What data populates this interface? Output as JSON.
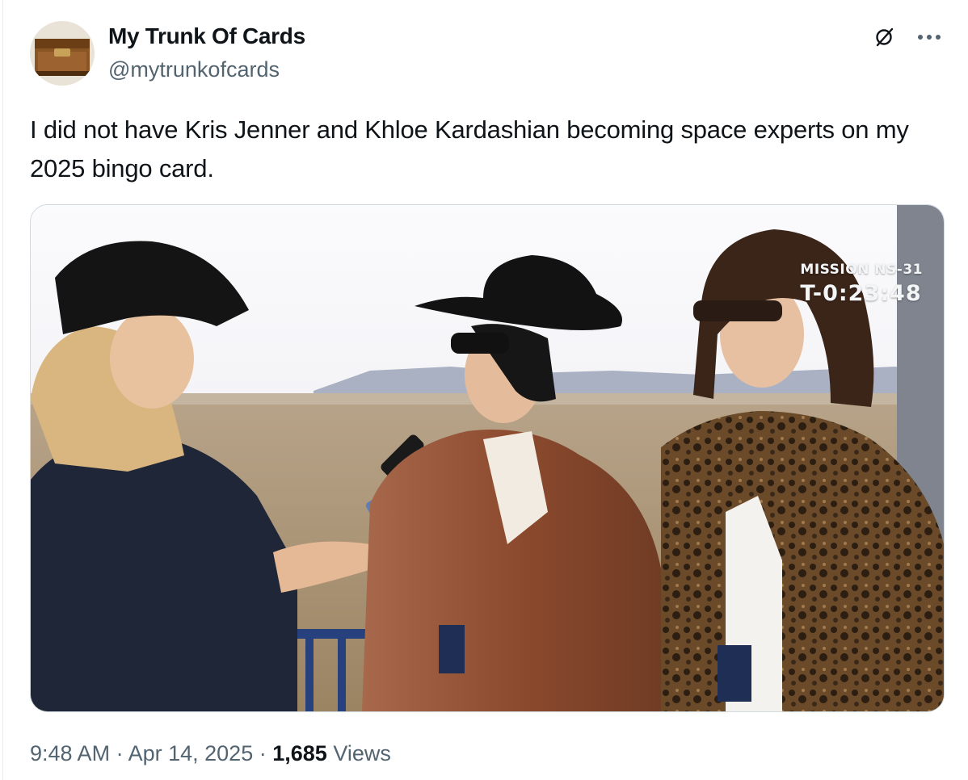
{
  "author": {
    "name": "My Trunk Of Cards",
    "handle": "@mytrunkofcards",
    "avatar_icon": "trunk-avatar"
  },
  "header_actions": {
    "grok_icon": "grok-icon",
    "more_icon": "more-icon"
  },
  "tweet": {
    "text": "I did not have Kris Jenner and Khloe Kardashian becoming space experts on my 2025 bingo card."
  },
  "media": {
    "overlay_line1": "MISSION NS-31",
    "overlay_line2": "T-0:23:48"
  },
  "meta": {
    "time": "9:48 AM",
    "separator": "·",
    "date": "Apr 14, 2025",
    "views_count": "1,685",
    "views_label": "Views"
  },
  "colors": {
    "text_primary": "#0f1419",
    "text_secondary": "#536471",
    "border": "#cfd9de"
  }
}
